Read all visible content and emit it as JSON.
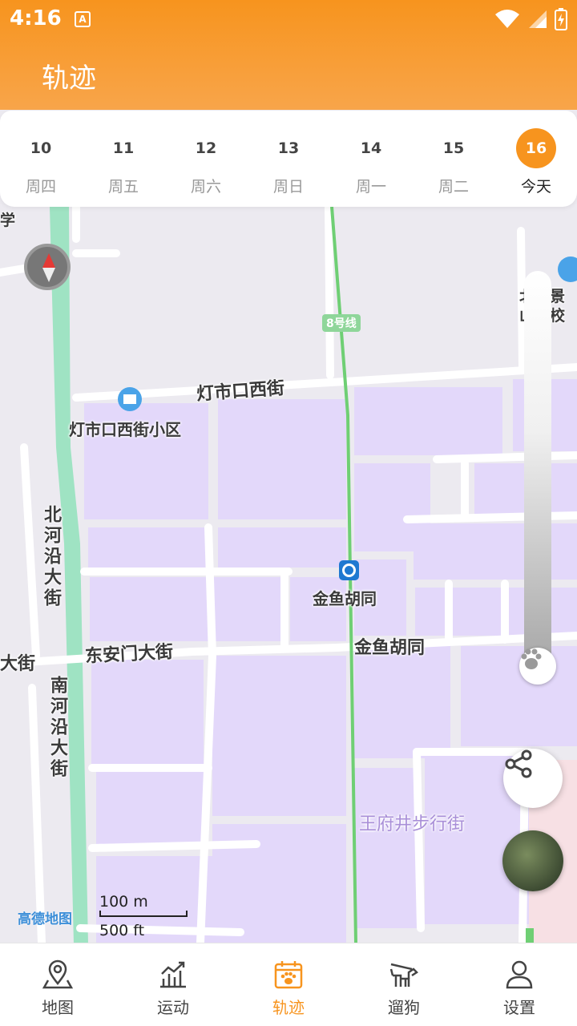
{
  "status_bar": {
    "time": "4:16",
    "notification_icon": "A"
  },
  "header": {
    "title": "轨迹"
  },
  "dates": [
    {
      "day": "10",
      "weekday": "周四",
      "active": false
    },
    {
      "day": "11",
      "weekday": "周五",
      "active": false
    },
    {
      "day": "12",
      "weekday": "周六",
      "active": false
    },
    {
      "day": "13",
      "weekday": "周日",
      "active": false
    },
    {
      "day": "14",
      "weekday": "周一",
      "active": false
    },
    {
      "day": "15",
      "weekday": "周二",
      "active": false
    },
    {
      "day": "16",
      "weekday": "今天",
      "active": true
    }
  ],
  "map": {
    "labels": {
      "metro_line": "8号线",
      "street_dengshikou": "灯市口西街",
      "community": "灯市口西街小区",
      "beiheyan": "北河沿大街",
      "nanheyan": "南河沿大街",
      "donganmen": "东安门大街",
      "dajie_left": "大街",
      "station": "金鱼胡同",
      "street_jinyu": "金鱼胡同",
      "wangfujing": "王府井步行街",
      "school_partial": "北京景山学校南校",
      "left_partial": "学"
    },
    "scale_metric": "100 m",
    "scale_imperial": "500 ft",
    "logo": "高德地图"
  },
  "colors": {
    "accent": "#f7941e",
    "block": "#e3d8fa",
    "green": "#9fe3c3",
    "metro": "#6fcf74"
  },
  "bottom_nav": [
    {
      "label": "地图",
      "icon": "map-pin-icon",
      "active": false
    },
    {
      "label": "运动",
      "icon": "chart-icon",
      "active": false
    },
    {
      "label": "轨迹",
      "icon": "calendar-paw-icon",
      "active": true
    },
    {
      "label": "遛狗",
      "icon": "dog-walk-icon",
      "active": false
    },
    {
      "label": "设置",
      "icon": "user-icon",
      "active": false
    }
  ]
}
